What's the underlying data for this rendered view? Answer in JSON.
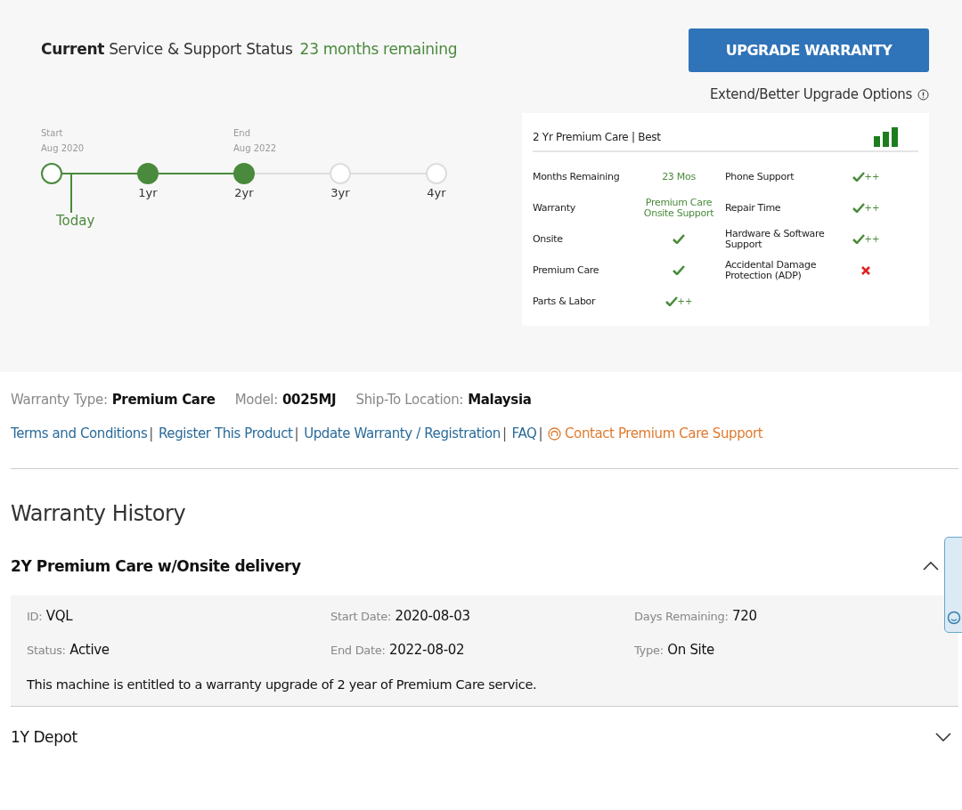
{
  "status": {
    "title_bold": "Current",
    "title_rest": "Service & Support Status",
    "remaining": "23 months remaining"
  },
  "upgrade_button": "UPGRADE WARRANTY",
  "upgrade_options": "Extend/Better Upgrade Options",
  "timeline": {
    "today": "Today",
    "nodes": [
      {
        "top": "Start",
        "date": "Aug 2020",
        "reached": true,
        "filled": false
      },
      {
        "label": "1yr",
        "reached": true,
        "filled": true
      },
      {
        "top": "End",
        "date": "Aug 2022",
        "label": "2yr",
        "reached": true,
        "filled": true
      },
      {
        "label": "3yr",
        "reached": false,
        "filled": false
      },
      {
        "label": "4yr",
        "reached": false,
        "filled": false
      }
    ]
  },
  "plan_card": {
    "title": "2 Yr Premium Care | Best",
    "features": [
      {
        "label": "Months Remaining",
        "kind": "text",
        "value": "23 Mos"
      },
      {
        "label": "Phone Support",
        "kind": "check",
        "suffix": "++"
      },
      {
        "label": "Warranty",
        "kind": "text",
        "value": "Premium Care Onsite Support"
      },
      {
        "label": "Repair Time",
        "kind": "check",
        "suffix": "++"
      },
      {
        "label": "Onsite",
        "kind": "check"
      },
      {
        "label": "Hardware & Software Support",
        "kind": "check",
        "suffix": "++"
      },
      {
        "label": "Premium Care",
        "kind": "check"
      },
      {
        "label": "Accidental Damage Protection (ADP)",
        "kind": "cross"
      },
      {
        "label": "Parts & Labor",
        "kind": "check",
        "suffix": "++"
      }
    ]
  },
  "details": [
    {
      "label": "Warranty Type:",
      "value": "Premium Care"
    },
    {
      "label": "Model:",
      "value": "0025MJ"
    },
    {
      "label": "Ship-To Location:",
      "value": "Malaysia"
    }
  ],
  "links": [
    {
      "text": "Terms and Conditions",
      "kind": "link",
      "separator": "|"
    },
    {
      "text": "Register This Product",
      "kind": "link",
      "separator": "|"
    },
    {
      "text": "Update Warranty / Registration",
      "kind": "link",
      "separator": "|"
    },
    {
      "text": "FAQ",
      "kind": "link",
      "separator": "|"
    },
    {
      "text": "Contact Premium Care Support",
      "kind": "contact"
    }
  ],
  "history": {
    "title": "Warranty History",
    "entries": [
      {
        "title": "2Y Premium Care w/Onsite delivery",
        "expanded": true,
        "fields": [
          {
            "label": "ID:",
            "value": "VQL"
          },
          {
            "label": "Start Date:",
            "value": "2020-08-03"
          },
          {
            "label": "Days Remaining:",
            "value": "720"
          },
          {
            "label": "Status:",
            "value": "Active"
          },
          {
            "label": "End Date:",
            "value": "2022-08-02"
          },
          {
            "label": "Type:",
            "value": "On Site"
          }
        ],
        "note": "This machine is entitled to a warranty upgrade of 2 year of Premium Care service."
      },
      {
        "title": "1Y Depot",
        "expanded": false
      }
    ]
  }
}
